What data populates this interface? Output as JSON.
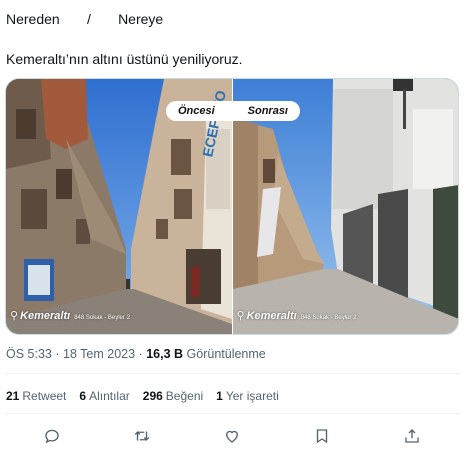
{
  "header": {
    "from": "Nereden",
    "separator": "/",
    "to": "Nereye"
  },
  "tweet": {
    "text": "Kemeraltı’nın altını üstünü yeniliyoruz."
  },
  "media": {
    "before_label": "Öncesi",
    "after_label": "Sonrası",
    "location_name": "Kemeraltı",
    "location_street": "848 Sokak - Beyler 2",
    "sign_text": "ECEFOTO"
  },
  "meta": {
    "time": "ÖS 5:33",
    "dot": "·",
    "date": "18 Tem 2023",
    "views_count": "16,3 B",
    "views_label": "Görüntülenme"
  },
  "stats": {
    "retweets_count": "21",
    "retweets_label": "Retweet",
    "quotes_count": "6",
    "quotes_label": "Alıntılar",
    "likes_count": "296",
    "likes_label": "Beğeni",
    "bookmarks_count": "1",
    "bookmarks_label": "Yer işareti"
  },
  "actions": [
    "reply-icon",
    "retweet-icon",
    "like-icon",
    "bookmark-icon",
    "share-icon"
  ],
  "colors": {
    "text": "#0f1419",
    "secondary": "#536471",
    "sky": "#3d7fd6",
    "border": "#cfd9de"
  }
}
